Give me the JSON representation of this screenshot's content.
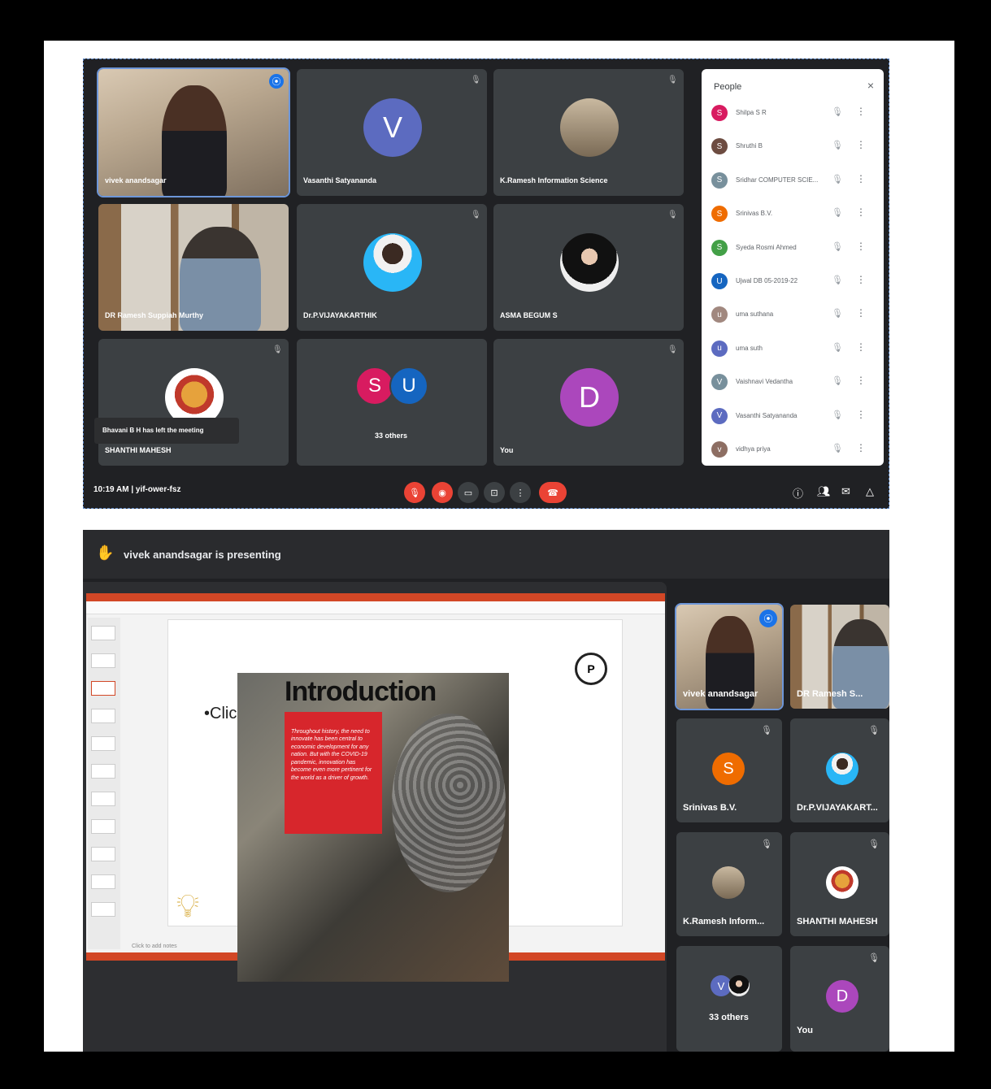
{
  "top_meeting": {
    "tiles": [
      {
        "name": "vivek anandsagar",
        "kind": "video"
      },
      {
        "name": "Vasanthi Satyananda",
        "initial": "V",
        "color": "#5c6bc0"
      },
      {
        "name": "K.Ramesh Information Science",
        "kind": "photo"
      },
      {
        "name": "DR Ramesh Suppiah Murthy",
        "kind": "video"
      },
      {
        "name": "Dr.P.VIJAYAKARTHIK",
        "kind": "photo"
      },
      {
        "name": "ASMA BEGUM S",
        "kind": "photo"
      },
      {
        "name": "SHANTHI MAHESH",
        "kind": "photo"
      },
      {
        "name": "33 others",
        "initials": [
          "S",
          "U"
        ],
        "colors": [
          "#d81b60",
          "#1565c0"
        ]
      },
      {
        "name": "You",
        "initial": "D",
        "color": "#ab47bc"
      }
    ],
    "toast": "Bhavani B H has left the meeting",
    "meeting_info": "10:19 AM | yif-ower-fsz",
    "people_panel": {
      "title": "People",
      "close": "×",
      "rows": [
        {
          "name": "Shilpa S R",
          "initial": "S",
          "color": "#d81b60"
        },
        {
          "name": "Shruthi B",
          "initial": "S",
          "color": "#6d4c41"
        },
        {
          "name": "Sridhar COMPUTER SCIE...",
          "initial": "S",
          "color": "#78909c"
        },
        {
          "name": "Srinivas B.V.",
          "initial": "S",
          "color": "#ef6c00"
        },
        {
          "name": "Syeda Rosmi Ahmed",
          "initial": "S",
          "color": "#43a047"
        },
        {
          "name": "Ujwal DB 05-2019-22",
          "initial": "U",
          "color": "#1565c0"
        },
        {
          "name": "uma suthana",
          "initial": "u",
          "color": "#a1887f"
        },
        {
          "name": "uma suth",
          "initial": "u",
          "color": "#5c6bc0"
        },
        {
          "name": "Vaishnavi Vedantha",
          "initial": "V",
          "color": "#78909c"
        },
        {
          "name": "Vasanthi Satyananda",
          "initial": "V",
          "color": "#5c6bc0"
        },
        {
          "name": "vidhya priya",
          "initial": "v",
          "color": "#8d6e63"
        }
      ]
    }
  },
  "bottom_meeting": {
    "presenting_text": "vivek anandsagar is presenting",
    "slide": {
      "title": "Introduction",
      "body": "Throughout history, the need to innovate has been central to economic development for any nation. But with the COVID-19 pandemic, innovation has become even more pertinent for the world as a driver of growth.",
      "placeholder": "•Clic",
      "logo": "P",
      "notes": "Click to add notes"
    },
    "side_tiles": [
      {
        "name": "vivek anandsagar",
        "kind": "video"
      },
      {
        "name": "DR Ramesh S...",
        "kind": "video"
      },
      {
        "name": "Srinivas B.V.",
        "initial": "S",
        "color": "#ef6c00"
      },
      {
        "name": "Dr.P.VIJAYAKART...",
        "kind": "photo"
      },
      {
        "name": "K.Ramesh Inform...",
        "kind": "photo"
      },
      {
        "name": "SHANTHI MAHESH",
        "kind": "photo"
      },
      {
        "name": "33 others",
        "initial": "V",
        "color": "#5c6bc0"
      },
      {
        "name": "You",
        "initial": "D",
        "color": "#ab47bc"
      }
    ]
  }
}
